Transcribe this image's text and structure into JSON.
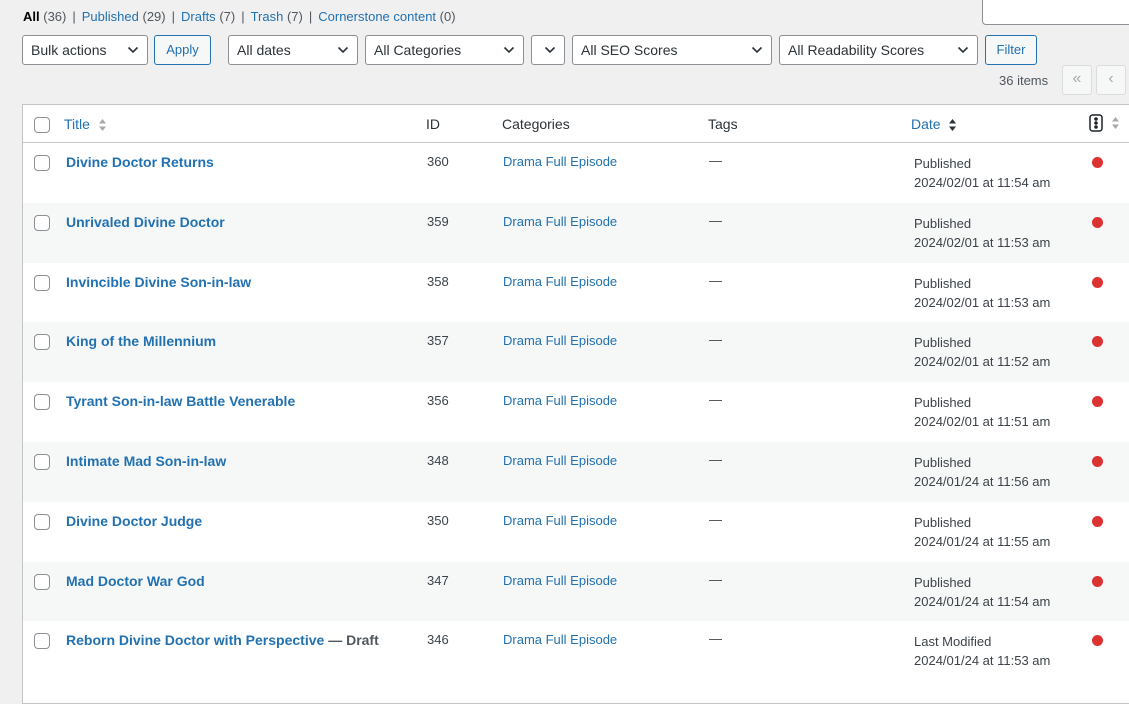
{
  "status_filters": [
    {
      "label": "All",
      "count": "(36)",
      "current": true
    },
    {
      "label": "Published",
      "count": "(29)"
    },
    {
      "label": "Drafts",
      "count": "(7)"
    },
    {
      "label": "Trash",
      "count": "(7)"
    },
    {
      "label": "Cornerstone content",
      "count": "(0)"
    }
  ],
  "separator": "|",
  "filters": {
    "bulk_actions": "Bulk actions",
    "apply": "Apply",
    "dates": "All dates",
    "categories": "All Categories",
    "empty_select": "",
    "seo_scores": "All SEO Scores",
    "readability_scores": "All Readability Scores",
    "filter": "Filter"
  },
  "pagination": {
    "items_count": "36 items",
    "first": "«",
    "prev": "‹"
  },
  "columns": {
    "title": "Title",
    "id": "ID",
    "categories": "Categories",
    "tags": "Tags",
    "date": "Date"
  },
  "colors": {
    "link": "#2271b1",
    "seo_bad": "#dc3232",
    "alt_row": "#f6f7f7"
  },
  "rows": [
    {
      "title": "Divine Doctor Returns",
      "state": "",
      "id": "360",
      "category": "Drama Full Episode",
      "tags": "—",
      "status": "Published",
      "date": "2024/02/01 at 11:54 am"
    },
    {
      "title": "Unrivaled Divine Doctor",
      "state": "",
      "id": "359",
      "category": "Drama Full Episode",
      "tags": "—",
      "status": "Published",
      "date": "2024/02/01 at 11:53 am"
    },
    {
      "title": "Invincible Divine Son-in-law",
      "state": "",
      "id": "358",
      "category": "Drama Full Episode",
      "tags": "—",
      "status": "Published",
      "date": "2024/02/01 at 11:53 am"
    },
    {
      "title": "King of the Millennium",
      "state": "",
      "id": "357",
      "category": "Drama Full Episode",
      "tags": "—",
      "status": "Published",
      "date": "2024/02/01 at 11:52 am"
    },
    {
      "title": "Tyrant Son-in-law Battle Venerable",
      "state": "",
      "id": "356",
      "category": "Drama Full Episode",
      "tags": "—",
      "status": "Published",
      "date": "2024/02/01 at 11:51 am"
    },
    {
      "title": "Intimate Mad Son-in-law",
      "state": "",
      "id": "348",
      "category": "Drama Full Episode",
      "tags": "—",
      "status": "Published",
      "date": "2024/01/24 at 11:56 am"
    },
    {
      "title": "Divine Doctor Judge",
      "state": "",
      "id": "350",
      "category": "Drama Full Episode",
      "tags": "—",
      "status": "Published",
      "date": "2024/01/24 at 11:55 am"
    },
    {
      "title": "Mad Doctor War God",
      "state": "",
      "id": "347",
      "category": "Drama Full Episode",
      "tags": "—",
      "status": "Published",
      "date": "2024/01/24 at 11:54 am"
    },
    {
      "title": "Reborn Divine Doctor with Perspective",
      "state": "— Draft",
      "id": "346",
      "category": "Drama Full Episode",
      "tags": "—",
      "status": "Last Modified",
      "date": "2024/01/24 at 11:53 am"
    }
  ]
}
